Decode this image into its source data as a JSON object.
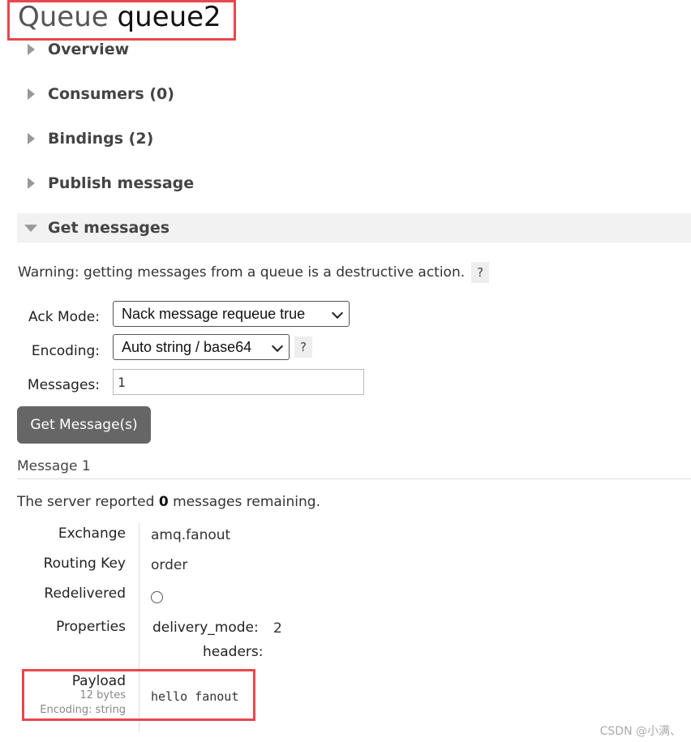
{
  "page": {
    "title_prefix": "Queue",
    "title_name": "queue2"
  },
  "sections": [
    {
      "label": "Overview",
      "expanded": false
    },
    {
      "label": "Consumers (0)",
      "expanded": false
    },
    {
      "label": "Bindings (2)",
      "expanded": false
    },
    {
      "label": "Publish message",
      "expanded": false
    },
    {
      "label": "Get messages",
      "expanded": true
    }
  ],
  "get_messages": {
    "warning": "Warning: getting messages from a queue is a destructive action.",
    "help_label": "?",
    "ack_mode_label": "Ack Mode:",
    "ack_mode_value": "Nack message requeue true",
    "encoding_label": "Encoding:",
    "encoding_value": "Auto string / base64",
    "messages_label": "Messages:",
    "messages_value": "1",
    "button_label": "Get Message(s)"
  },
  "result": {
    "message_heading": "Message 1",
    "remaining_prefix": "The server reported",
    "remaining_count": "0",
    "remaining_suffix": "messages remaining.",
    "exchange_label": "Exchange",
    "exchange_value": "amq.fanout",
    "routing_key_label": "Routing Key",
    "routing_key_value": "order",
    "redelivered_label": "Redelivered",
    "properties_label": "Properties",
    "delivery_mode_label": "delivery_mode:",
    "delivery_mode_value": "2",
    "headers_label": "headers:",
    "payload_label": "Payload",
    "payload_size": "12 bytes",
    "payload_encoding": "Encoding: string",
    "payload_value": "hello fanout"
  },
  "watermark": "CSDN @小满、",
  "colors": {
    "highlight": "#e8474c",
    "button_bg": "#666666",
    "section_open_bg": "#f2f2f2"
  }
}
